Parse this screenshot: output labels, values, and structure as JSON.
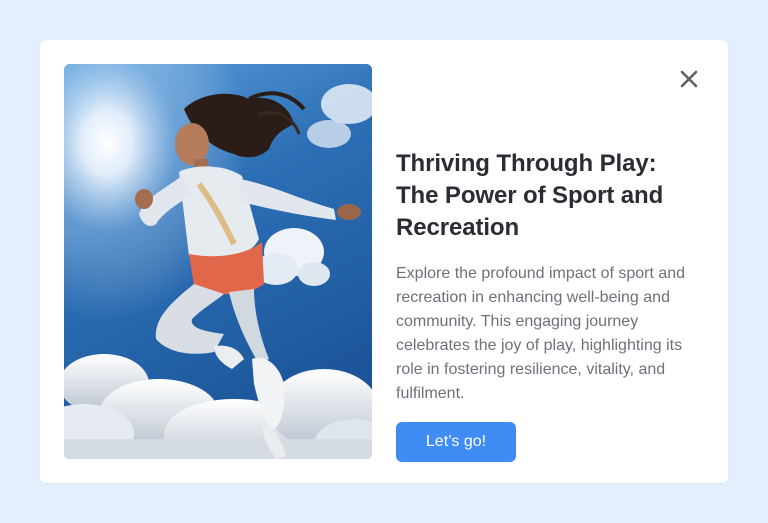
{
  "modal": {
    "close_icon": "close-icon",
    "title": "Thriving Through Play: The Power of Sport and Recreation",
    "description": "Explore the profound impact of sport and recreation in enhancing well-being and community. This engaging journey celebrates the joy of play, highlighting its role in fostering resilience, vitality, and fulfilment.",
    "cta_label": "Let’s go!",
    "image_icon": "hero-photo-athlete-jumping-sky"
  },
  "colors": {
    "page_background": "#e3effd",
    "card_background": "#ffffff",
    "title_text": "#2a2d33",
    "body_text": "#6d7179",
    "accent": "#3f8cf5",
    "close_icon": "#5b6068"
  }
}
